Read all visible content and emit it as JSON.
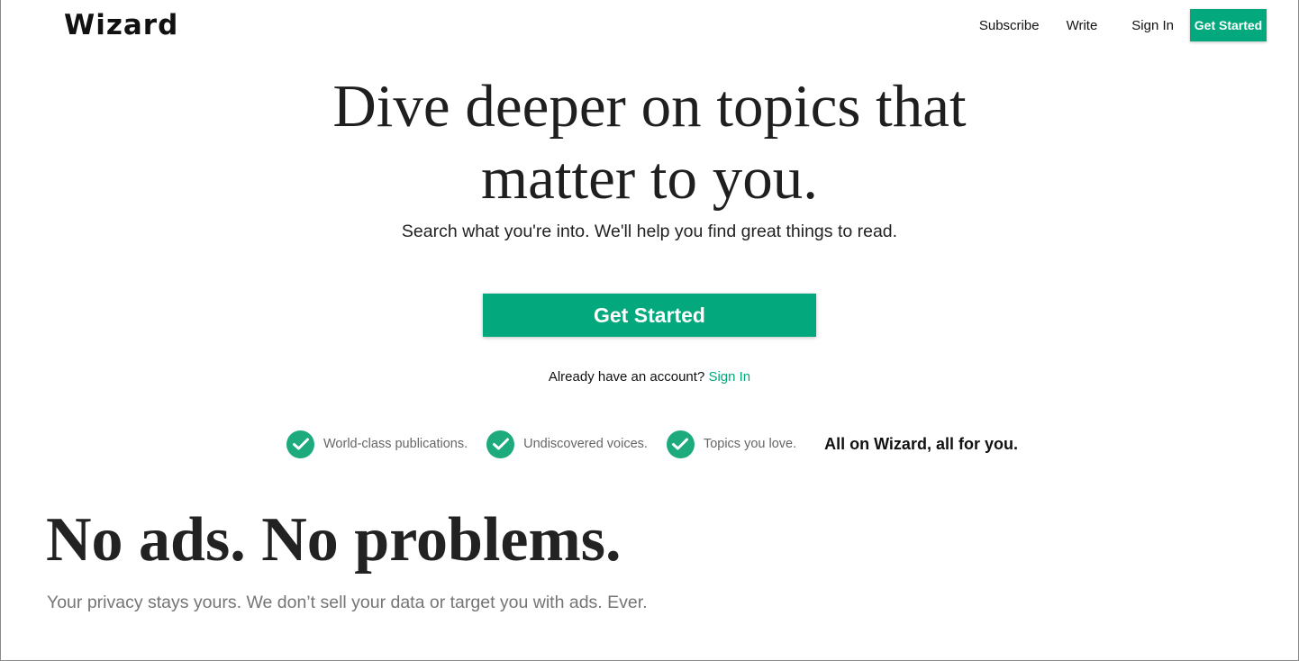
{
  "header": {
    "logo": "Wizard",
    "nav": {
      "subscribe": "Subscribe",
      "write": "Write",
      "sign_in": "Sign In",
      "get_started": "Get Started"
    }
  },
  "hero": {
    "title_line1": "Dive deeper on topics that",
    "title_line2": "matter to you.",
    "subtitle": "Search what you're into. We'll help you find great things to read.",
    "cta_label": "Get Started",
    "account_prompt": "Already have an account?",
    "account_link": "Sign In"
  },
  "features": {
    "items": [
      {
        "label": "World-class publications.",
        "icon": "check-icon"
      },
      {
        "label": "Undiscovered voices.",
        "icon": "check-icon"
      },
      {
        "label": "Topics you love.",
        "icon": "check-icon"
      }
    ],
    "tagline": "All on Wizard, all for you."
  },
  "privacy": {
    "title": "No ads. No problems.",
    "subtitle": "Your privacy stays yours. We don’t sell your data or target you with ads. Ever."
  },
  "colors": {
    "accent": "#03a87c",
    "text": "#111111",
    "muted": "#757575"
  }
}
